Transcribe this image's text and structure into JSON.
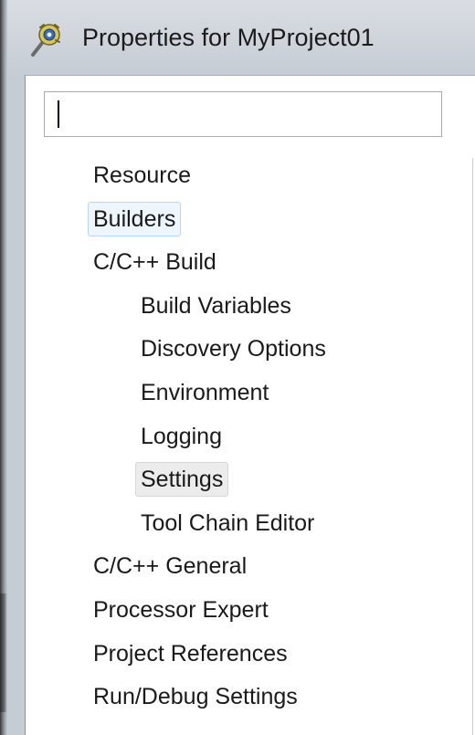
{
  "window": {
    "title": "Properties for MyProject01",
    "icon": "project-properties-icon"
  },
  "filter": {
    "value": "",
    "placeholder": ""
  },
  "tree": {
    "items": [
      {
        "label": "Resource",
        "level": 0,
        "state": "normal"
      },
      {
        "label": "Builders",
        "level": 0,
        "state": "hover"
      },
      {
        "label": "C/C++ Build",
        "level": 0,
        "state": "normal"
      },
      {
        "label": "Build Variables",
        "level": 1,
        "state": "normal"
      },
      {
        "label": "Discovery Options",
        "level": 1,
        "state": "normal"
      },
      {
        "label": "Environment",
        "level": 1,
        "state": "normal"
      },
      {
        "label": "Logging",
        "level": 1,
        "state": "normal"
      },
      {
        "label": "Settings",
        "level": 1,
        "state": "selected"
      },
      {
        "label": "Tool Chain Editor",
        "level": 1,
        "state": "normal"
      },
      {
        "label": "C/C++ General",
        "level": 0,
        "state": "normal"
      },
      {
        "label": "Processor Expert",
        "level": 0,
        "state": "normal"
      },
      {
        "label": "Project References",
        "level": 0,
        "state": "normal"
      },
      {
        "label": "Run/Debug Settings",
        "level": 0,
        "state": "normal"
      }
    ]
  },
  "colors": {
    "hover_background": "#eef5fd",
    "hover_border": "#b8d6fb",
    "selected_background": "#ececec",
    "selected_border": "#d6d6d6"
  }
}
